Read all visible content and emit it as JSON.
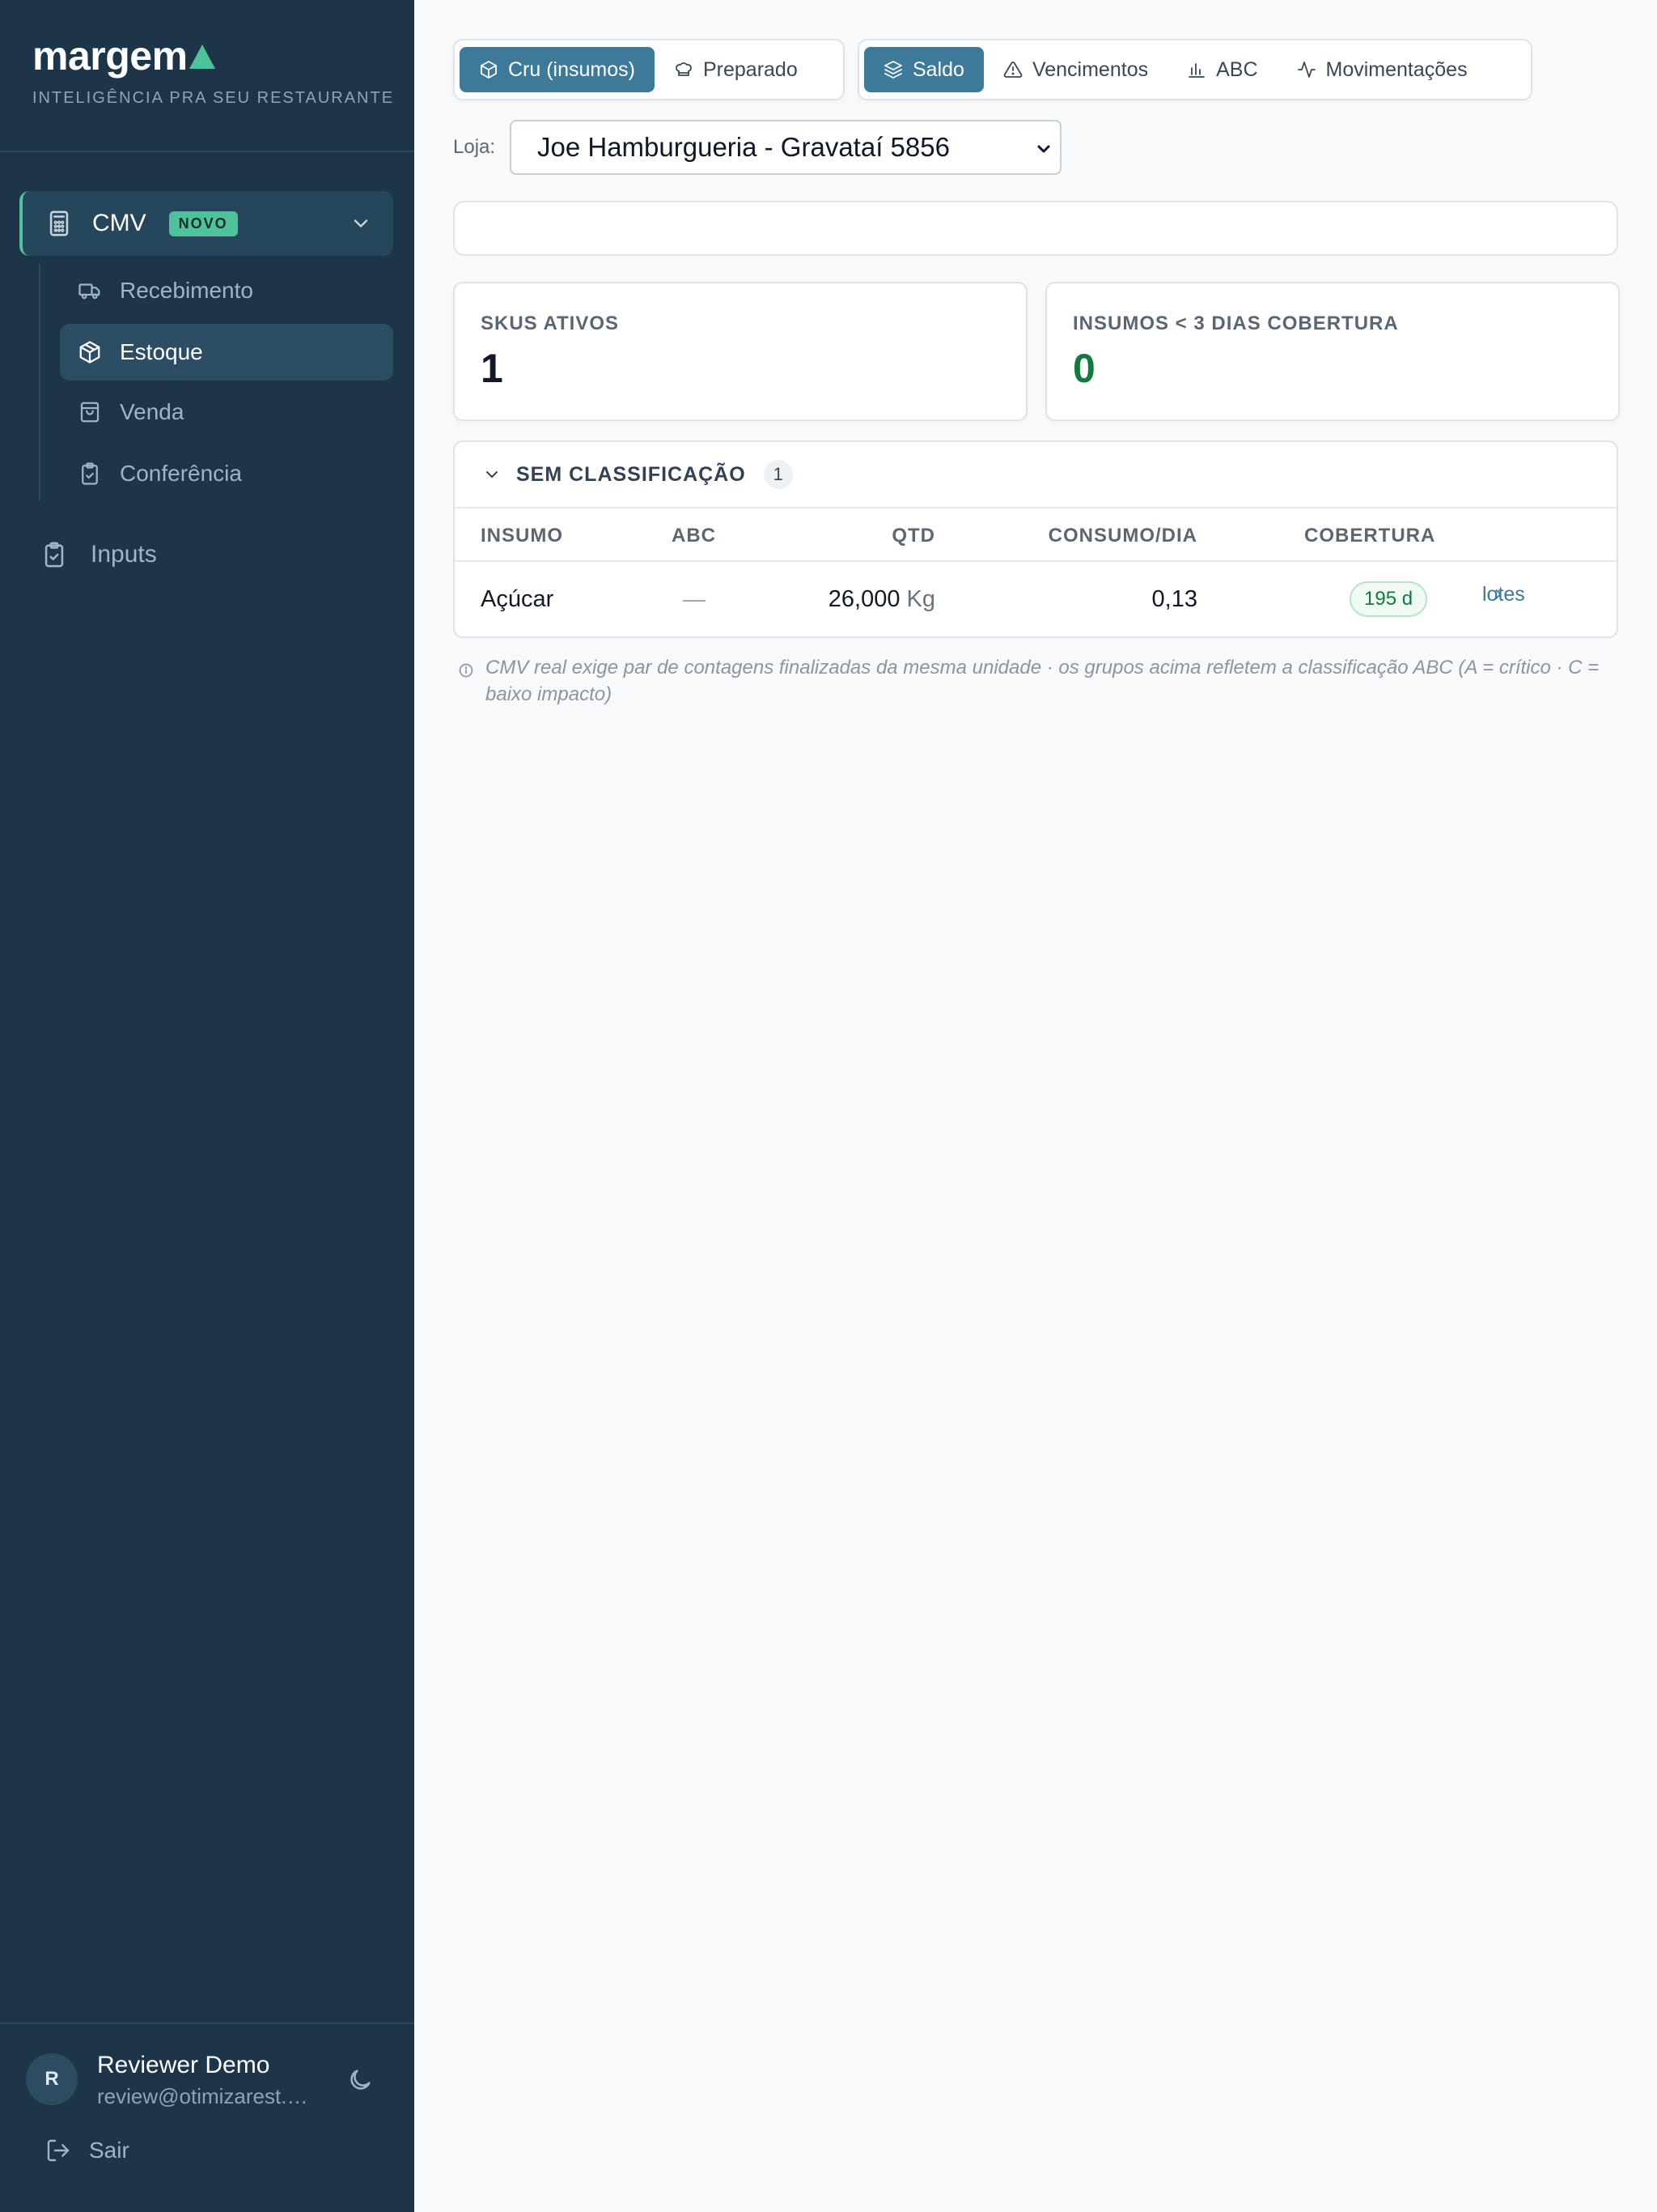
{
  "sidebar": {
    "brand_name": "margem",
    "brand_tagline": "INTELIGÊNCIA PRA SEU RESTAURANTE",
    "accent_color": "#4ec29a",
    "cmv": {
      "label": "CMV",
      "badge": "NOVO"
    },
    "sub_items": [
      {
        "label": "Recebimento",
        "icon": "truck-icon"
      },
      {
        "label": "Estoque",
        "icon": "box-icon",
        "active": true
      },
      {
        "label": "Venda",
        "icon": "shopping-bag-icon"
      },
      {
        "label": "Conferência",
        "icon": "clipboard-check-icon"
      }
    ],
    "inputs_label": "Inputs",
    "user": {
      "initial": "R",
      "name": "Reviewer Demo",
      "email": "review@otimizarest.com"
    },
    "logout_label": "Sair"
  },
  "toolbar": {
    "mode_tabs": [
      {
        "label": "Cru (insumos)",
        "active": true
      },
      {
        "label": "Preparado",
        "active": false
      }
    ],
    "view_tabs": [
      {
        "label": "Saldo",
        "active": true
      },
      {
        "label": "Vencimentos",
        "active": false
      },
      {
        "label": "ABC",
        "active": false
      },
      {
        "label": "Movimentações",
        "active": false
      }
    ]
  },
  "loja": {
    "label": "Loja:",
    "selected": "Joe Hamburgueria - Gravataí 5856"
  },
  "kpis": [
    {
      "title": "SKUS ATIVOS",
      "value": "1"
    },
    {
      "title": "INSUMOS < 3 DIAS COBERTURA",
      "value": "0"
    }
  ],
  "group": {
    "label": "SEM CLASSIFICAÇÃO",
    "count": "1",
    "columns": {
      "insumo": "INSUMO",
      "abc": "ABC",
      "qtd": "QTD",
      "consumo": "CONSUMO/DIA",
      "cobertura": "COBERTURA"
    },
    "rows": [
      {
        "insumo": "Açúcar",
        "abc": "—",
        "qtd": "26,000",
        "unit": "Kg",
        "consumo": "0,13",
        "cobertura": "195 d",
        "link": "lotes"
      }
    ]
  },
  "footnote": "CMV real exige par de contagens finalizadas da mesma unidade · os grupos acima refletem a classificação ABC (A = crítico · C = baixo impacto)",
  "colors": {
    "primary": "#3d7a99",
    "sidebar_bg": "#1c3549",
    "success": "#137a3d"
  }
}
